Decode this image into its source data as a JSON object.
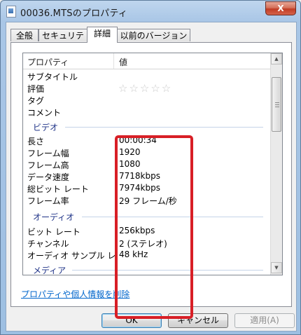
{
  "window": {
    "title": "00036.MTSのプロパティ",
    "close_glyph": "X"
  },
  "tabs": [
    {
      "label": "全般"
    },
    {
      "label": "セキュリティ"
    },
    {
      "label": "詳細"
    },
    {
      "label": "以前のバージョン"
    }
  ],
  "list": {
    "columns": {
      "property": "プロパティ",
      "value": "値"
    },
    "rows_top": [
      {
        "key": "サブタイトル",
        "value": ""
      },
      {
        "key": "評価",
        "value": ""
      },
      {
        "key": "タグ",
        "value": ""
      },
      {
        "key": "コメント",
        "value": ""
      }
    ],
    "rating_stars": "☆☆☆☆☆",
    "groups": {
      "video": {
        "label": "ビデオ",
        "rows": [
          {
            "key": "長さ",
            "value": "00:00:34"
          },
          {
            "key": "フレーム幅",
            "value": "1920"
          },
          {
            "key": "フレーム高",
            "value": "1080"
          },
          {
            "key": "データ速度",
            "value": "7718kbps"
          },
          {
            "key": "総ビット レート",
            "value": "7974kbps"
          },
          {
            "key": "フレーム率",
            "value": "29 フレーム/秒"
          }
        ]
      },
      "audio": {
        "label": "オーディオ",
        "rows": [
          {
            "key": "ビット レート",
            "value": "256kbps"
          },
          {
            "key": "チャンネル",
            "value": "2 (ステレオ)"
          },
          {
            "key": "オーディオ サンプル レート",
            "value": "48 kHz"
          }
        ]
      },
      "media": {
        "label": "メディア"
      }
    }
  },
  "remove_link": "プロパティや個人情報を削除",
  "buttons": {
    "ok": "OK",
    "cancel": "キャンセル",
    "apply": "適用(A)"
  },
  "colors": {
    "highlight": "#d81f26",
    "group_text": "#1e3287",
    "link": "#0066cc"
  }
}
